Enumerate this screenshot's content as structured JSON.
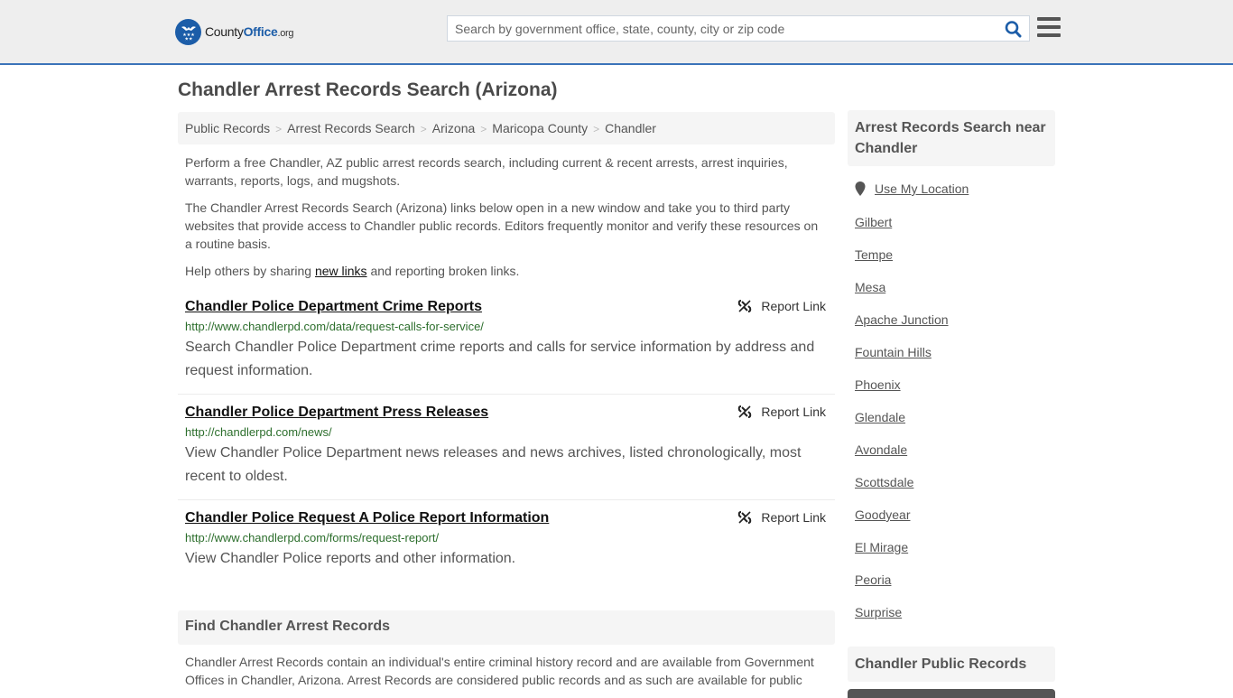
{
  "header": {
    "logo": {
      "county": "County",
      "office": "Office",
      "org": ".org"
    },
    "search_placeholder": "Search by government office, state, county, city or zip code",
    "search_value": "",
    "search_icon": "search-icon",
    "menu_icon": "hamburger-menu-icon",
    "accent_color": "#1c5da8"
  },
  "page": {
    "title": "Chandler Arrest Records Search (Arizona)",
    "breadcrumb": [
      "Public Records",
      "Arrest Records Search",
      "Arizona",
      "Maricopa County",
      "Chandler"
    ],
    "intro": {
      "p1": "Perform a free Chandler, AZ public arrest records search, including current & recent arrests, arrest inquiries, warrants, reports, logs, and mugshots.",
      "p2": "The Chandler Arrest Records Search (Arizona) links below open in a new window and take you to third party websites that provide access to Chandler public records. Editors frequently monitor and verify these resources on a routine basis.",
      "p3_before": "Help others by sharing ",
      "p3_link": "new links",
      "p3_after": " and reporting broken links."
    },
    "results": [
      {
        "title": "Chandler Police Department Crime Reports",
        "url": "http://www.chandlerpd.com/data/request-calls-for-service/",
        "description": "Search Chandler Police Department crime reports and calls for service information by address and request information.",
        "report_label": "Report Link"
      },
      {
        "title": "Chandler Police Department Press Releases",
        "url": "http://chandlerpd.com/news/",
        "description": "View Chandler Police Department news releases and news archives, listed chronologically, most recent to oldest.",
        "report_label": "Report Link"
      },
      {
        "title": "Chandler Police Request A Police Report Information",
        "url": "http://www.chandlerpd.com/forms/request-report/",
        "description": "View Chandler Police reports and other information.",
        "report_label": "Report Link"
      }
    ],
    "find_section": {
      "heading": "Find Chandler Arrest Records",
      "text": "Chandler Arrest Records contain an individual's entire criminal history record and are available from Government Offices in Chandler, Arizona. Arrest Records are considered public records and as such are available for public"
    }
  },
  "sidebar": {
    "nearby_heading": "Arrest Records Search near Chandler",
    "use_location": "Use My Location",
    "cities": [
      "Gilbert",
      "Tempe",
      "Mesa",
      "Apache Junction",
      "Fountain Hills",
      "Phoenix",
      "Glendale",
      "Avondale",
      "Scottsdale",
      "Goodyear",
      "El Mirage",
      "Peoria",
      "Surprise"
    ],
    "public_records_heading": "Chandler Public Records"
  }
}
